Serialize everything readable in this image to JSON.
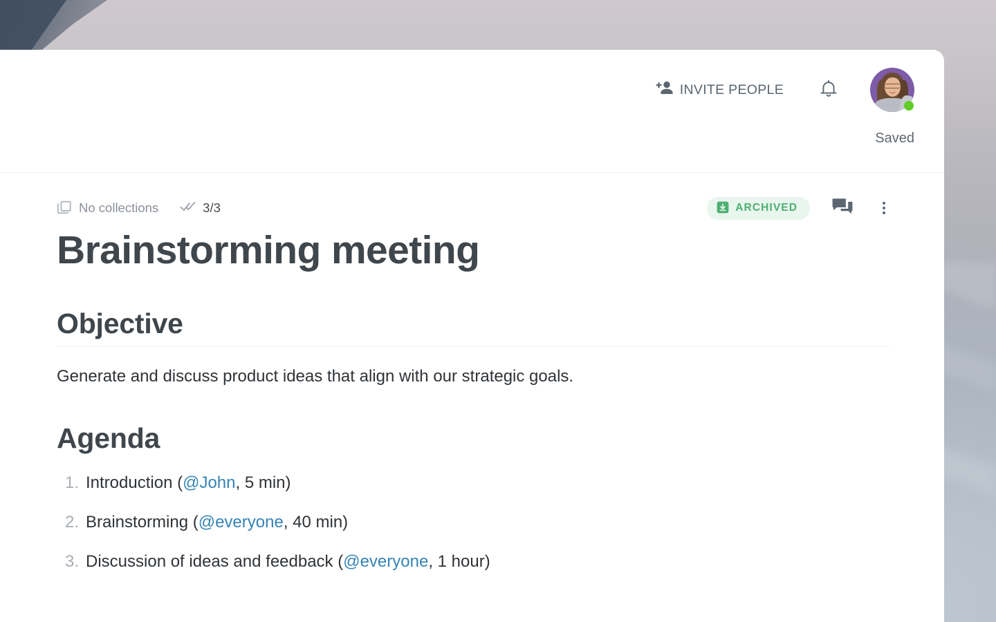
{
  "window": {
    "background_description": "blurred mountain landscape wallpaper"
  },
  "topbar": {
    "invite_label": "INVITE PEOPLE",
    "invite_icon": "person-add-icon",
    "notifications_icon": "bell-icon",
    "avatar_icon": "user-avatar",
    "presence_status_color": "#5fcd26",
    "save_status": "Saved"
  },
  "document": {
    "collections_label": "No collections",
    "collections_icon": "collections-icon",
    "tasks_icon": "double-check-icon",
    "tasks_count": "3/3",
    "status_badge": {
      "label": "ARCHIVED",
      "icon": "archive-box-icon",
      "color": "#4caf72",
      "background": "#e9f6ee"
    },
    "comments_icon": "comments-icon",
    "more_icon": "more-vertical-icon",
    "title": "Brainstorming meeting",
    "sections": [
      {
        "heading": "Objective",
        "paragraph": "Generate and discuss product ideas that align with our strategic goals."
      },
      {
        "heading": "Agenda"
      }
    ],
    "agenda": [
      {
        "before": "Introduction (",
        "mention": "@John",
        "after": ", 5 min)"
      },
      {
        "before": "Brainstorming (",
        "mention": "@everyone",
        "after": ", 40 min)"
      },
      {
        "before": "Discussion of ideas and feedback (",
        "mention": "@everyone",
        "after": ", 1 hour)"
      }
    ]
  },
  "colors": {
    "mention_link": "#3583b5",
    "text_primary": "#2f3337",
    "heading": "#3f464c",
    "muted": "#8a9099"
  }
}
